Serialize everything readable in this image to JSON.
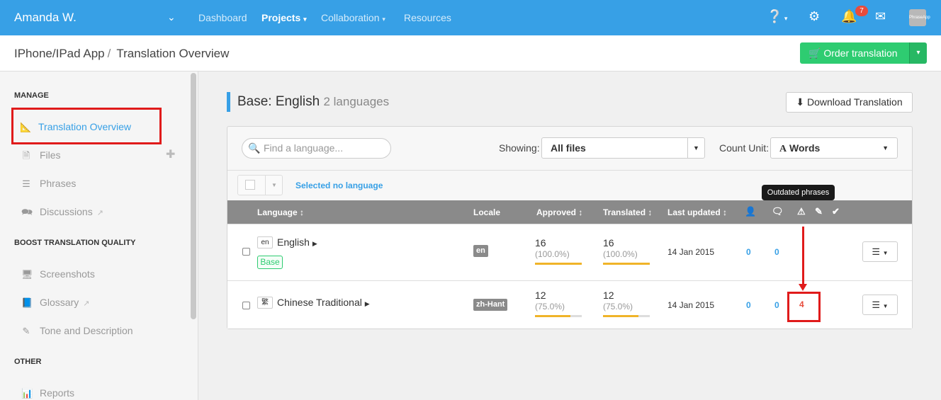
{
  "topbar": {
    "user": "Amanda W.",
    "nav": [
      "Dashboard",
      "Projects",
      "Collaboration",
      "Resources"
    ],
    "notifications_count": "7",
    "avatar_text": "PhraseApp"
  },
  "header": {
    "project": "IPhone/IPad App",
    "separator": "/",
    "page": "Translation Overview",
    "order_button": "Order translation"
  },
  "sidebar": {
    "sections": [
      {
        "heading": "MANAGE",
        "items": [
          {
            "label": "Translation Overview",
            "icon": "translate-icon",
            "active": true
          },
          {
            "label": "Files",
            "icon": "file-icon"
          },
          {
            "label": "Phrases",
            "icon": "list-icon"
          },
          {
            "label": "Discussions",
            "icon": "comments-icon",
            "external": true
          }
        ]
      },
      {
        "heading": "BOOST TRANSLATION QUALITY",
        "items": [
          {
            "label": "Screenshots",
            "icon": "monitor-icon"
          },
          {
            "label": "Glossary",
            "icon": "book-icon",
            "external": true
          },
          {
            "label": "Tone and Description",
            "icon": "pencil-icon"
          }
        ]
      },
      {
        "heading": "OTHER",
        "items": [
          {
            "label": "Reports",
            "icon": "chart-icon"
          }
        ]
      }
    ]
  },
  "main": {
    "title": "Base: English",
    "subtitle": "2 languages",
    "download_button": "Download Translation",
    "search_placeholder": "Find a language...",
    "showing_label": "Showing:",
    "showing_value": "All files",
    "count_unit_label": "Count Unit:",
    "count_unit_value": "Words",
    "selected_text": "Selected no language",
    "tooltip": "Outdated phrases",
    "columns": [
      "Language",
      "Locale",
      "Approved",
      "Translated",
      "Last updated"
    ],
    "rows": [
      {
        "flag": "en",
        "name": "English",
        "base": "Base",
        "locale": "en",
        "approved": "16",
        "approved_pct": "(100.0%)",
        "approved_fraction": 1.0,
        "translated": "16",
        "translated_pct": "(100.0%)",
        "translated_fraction": 1.0,
        "updated": "14 Jan 2015",
        "users": "0",
        "comments": "0",
        "outdated": ""
      },
      {
        "flag": "繁",
        "name": "Chinese Traditional",
        "locale": "zh-Hant",
        "approved": "12",
        "approved_pct": "(75.0%)",
        "approved_fraction": 0.75,
        "translated": "12",
        "translated_pct": "(75.0%)",
        "translated_fraction": 0.75,
        "updated": "14 Jan 2015",
        "users": "0",
        "comments": "0",
        "outdated": "4"
      }
    ]
  },
  "colors": {
    "primary": "#37a0e6",
    "success": "#2ecc71",
    "annotation": "#e01b1b"
  }
}
